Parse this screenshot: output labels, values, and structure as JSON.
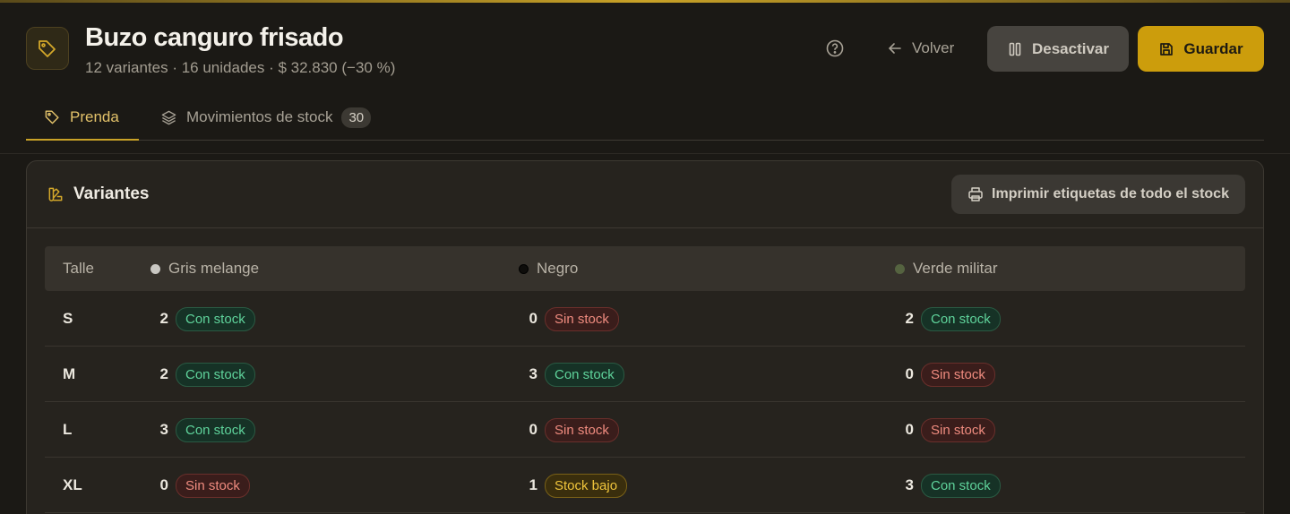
{
  "header": {
    "title": "Buzo canguro frisado",
    "subtitle": "12 variantes · 16 unidades · $ 32.830 (−30 %)",
    "back_label": "Volver",
    "deactivate_label": "Desactivar",
    "save_label": "Guardar"
  },
  "tabs": [
    {
      "label": "Prenda"
    },
    {
      "label": "Movimientos de stock",
      "count": "30"
    }
  ],
  "variants": {
    "title": "Variantes",
    "print_label": "Imprimir etiquetas de todo el stock",
    "size_header": "Talle",
    "colors": [
      {
        "name": "Gris melange",
        "swatch": "#c9c7c2"
      },
      {
        "name": "Negro",
        "swatch": "#0e0d0b"
      },
      {
        "name": "Verde militar",
        "swatch": "#556340"
      }
    ],
    "rows": [
      {
        "size": "S",
        "cells": [
          {
            "qty": "2",
            "status": "Con stock",
            "kind": "ok"
          },
          {
            "qty": "0",
            "status": "Sin stock",
            "kind": "no"
          },
          {
            "qty": "2",
            "status": "Con stock",
            "kind": "ok"
          }
        ]
      },
      {
        "size": "M",
        "cells": [
          {
            "qty": "2",
            "status": "Con stock",
            "kind": "ok"
          },
          {
            "qty": "3",
            "status": "Con stock",
            "kind": "ok"
          },
          {
            "qty": "0",
            "status": "Sin stock",
            "kind": "no"
          }
        ]
      },
      {
        "size": "L",
        "cells": [
          {
            "qty": "3",
            "status": "Con stock",
            "kind": "ok"
          },
          {
            "qty": "0",
            "status": "Sin stock",
            "kind": "no"
          },
          {
            "qty": "0",
            "status": "Sin stock",
            "kind": "no"
          }
        ]
      },
      {
        "size": "XL",
        "cells": [
          {
            "qty": "0",
            "status": "Sin stock",
            "kind": "no"
          },
          {
            "qty": "1",
            "status": "Stock bajo",
            "kind": "low"
          },
          {
            "qty": "3",
            "status": "Con stock",
            "kind": "ok"
          }
        ]
      }
    ]
  },
  "colors": {
    "accent": "#cc9d0c",
    "ok": "#5fd39b",
    "no": "#ef8b7f",
    "low": "#f0c53c"
  }
}
